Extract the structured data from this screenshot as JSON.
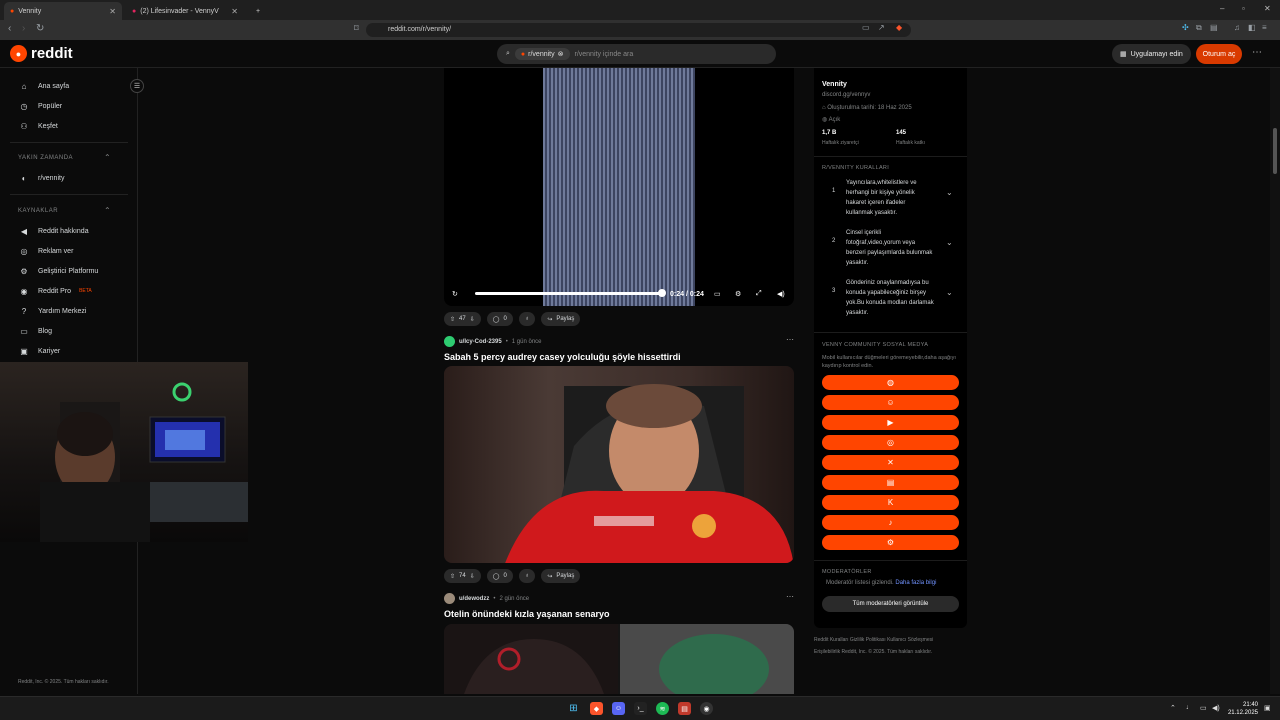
{
  "browser": {
    "tabs": [
      {
        "label": "Vennity",
        "active": true
      },
      {
        "label": "(2) Lifesinvader - VennyV",
        "active": false
      }
    ],
    "url": "reddit.com/r/vennity/"
  },
  "header": {
    "logo_text": "reddit",
    "search_chip": "r/vennity",
    "search_placeholder": "r/vennity içinde ara",
    "app_button": "Uygulamayı edin",
    "login_button": "Oturum aç"
  },
  "sidebar": {
    "nav": [
      {
        "label": "Ana sayfa",
        "icon": "home-icon",
        "glyph": "⌂"
      },
      {
        "label": "Popüler",
        "icon": "popular-icon",
        "glyph": "◷"
      },
      {
        "label": "Keşfet",
        "icon": "explore-icon",
        "glyph": "⚇"
      }
    ],
    "recent_heading": "YAKIN ZAMANDA",
    "recent_items": [
      {
        "label": "r/vennity"
      }
    ],
    "resources_heading": "KAYNAKLAR",
    "resources": [
      {
        "label": "Reddit hakkında",
        "icon": "megaphone-icon",
        "glyph": "◀"
      },
      {
        "label": "Reklam ver",
        "icon": "advertise-icon",
        "glyph": "◎"
      },
      {
        "label": "Geliştirici Platformu",
        "icon": "developer-icon",
        "glyph": "⚙"
      },
      {
        "label": "Reddit Pro",
        "icon": "pro-icon",
        "glyph": "◉",
        "badge": "BETA"
      },
      {
        "label": "Yardım Merkezi",
        "icon": "help-icon",
        "glyph": "?"
      },
      {
        "label": "Blog",
        "icon": "blog-icon",
        "glyph": "▭"
      },
      {
        "label": "Kariyer",
        "icon": "careers-icon",
        "glyph": "▣"
      }
    ],
    "footer": "Reddit, Inc. © 2025. Tüm hakları saklıdır."
  },
  "feed": {
    "video_post": {
      "votes": "47",
      "comments": "0",
      "share": "Paylaş",
      "time": "0:24 / 0:24"
    },
    "posts": [
      {
        "author": "u/Icy-Cod-2395",
        "age": "1 gün önce",
        "title": "Sabah 5 percy audrey casey yolculuğu şöyle hissettirdi",
        "votes": "74",
        "comments": "0",
        "share": "Paylaş"
      },
      {
        "author": "u/dewodzz",
        "age": "2 gün önce",
        "title": "Otelin önündeki kızla yaşanan senaryo"
      }
    ]
  },
  "community": {
    "name": "Vennity",
    "link": "discord.gg/vennyv",
    "created": "Oluşturulma tarihi: 18 Haz 2025",
    "visibility": "Açık",
    "stats": [
      {
        "value": "1,7 B",
        "label": "Haftalık ziyaretçi"
      },
      {
        "value": "145",
        "label": "Haftalık katkı"
      }
    ],
    "rules_heading": "R/VENNITY KURALLARI",
    "rules": [
      {
        "num": "1",
        "text": "Yayıncılara,whitelistlere ve herhangi bir kişiye yönelik hakaret içeren ifadeler kullanmak yasaktır."
      },
      {
        "num": "2",
        "text": "Cinsel içerikli fotoğraf,video,yorum veya benzeri paylaşımlarda bulunmak yasaktır."
      },
      {
        "num": "3",
        "text": "Gönderiniz onaylanmadıysa bu konuda yapabileceğiniz birşey yok.Bu konuda modları darlamak yasaktır."
      }
    ],
    "social_heading": "VENNY COMMUNITY SOSYAL MEDYA",
    "social_note": "Mobil kullanıcılar düğmeleri göremeyebilir,daha aşağıyı kaydırıp kontrol edin.",
    "social_buttons": [
      {
        "icon": "website-icon",
        "glyph": "◍"
      },
      {
        "icon": "discord-icon",
        "glyph": "☺"
      },
      {
        "icon": "youtube-icon",
        "glyph": "▶"
      },
      {
        "icon": "instagram-icon",
        "glyph": "◎"
      },
      {
        "icon": "x-icon",
        "glyph": "✕"
      },
      {
        "icon": "twitch-icon",
        "glyph": "▤"
      },
      {
        "icon": "kick-icon",
        "glyph": "K"
      },
      {
        "icon": "tiktok-icon",
        "glyph": "♪"
      },
      {
        "icon": "steam-icon",
        "glyph": "⚙"
      }
    ],
    "moderators_heading": "MODERATÖRLER",
    "moderators_hidden": "Moderatör listesi gizlendi.",
    "moderators_more": "Daha fazla bilgi",
    "moderators_button": "Tüm moderatörleri görüntüle",
    "footer_links": [
      "Reddit Kuralları",
      "Gizlilik Politikası",
      "Kullanıcı Sözleşmesi",
      "Erişilebilirlik",
      "Reddit, Inc. © 2025. Tüm hakları saklıdır."
    ]
  },
  "taskbar": {
    "time": "21:40",
    "date": "21.12.2025"
  },
  "colors": {
    "accent": "#ff4500",
    "login": "#d93a00",
    "link": "#7193ff"
  }
}
